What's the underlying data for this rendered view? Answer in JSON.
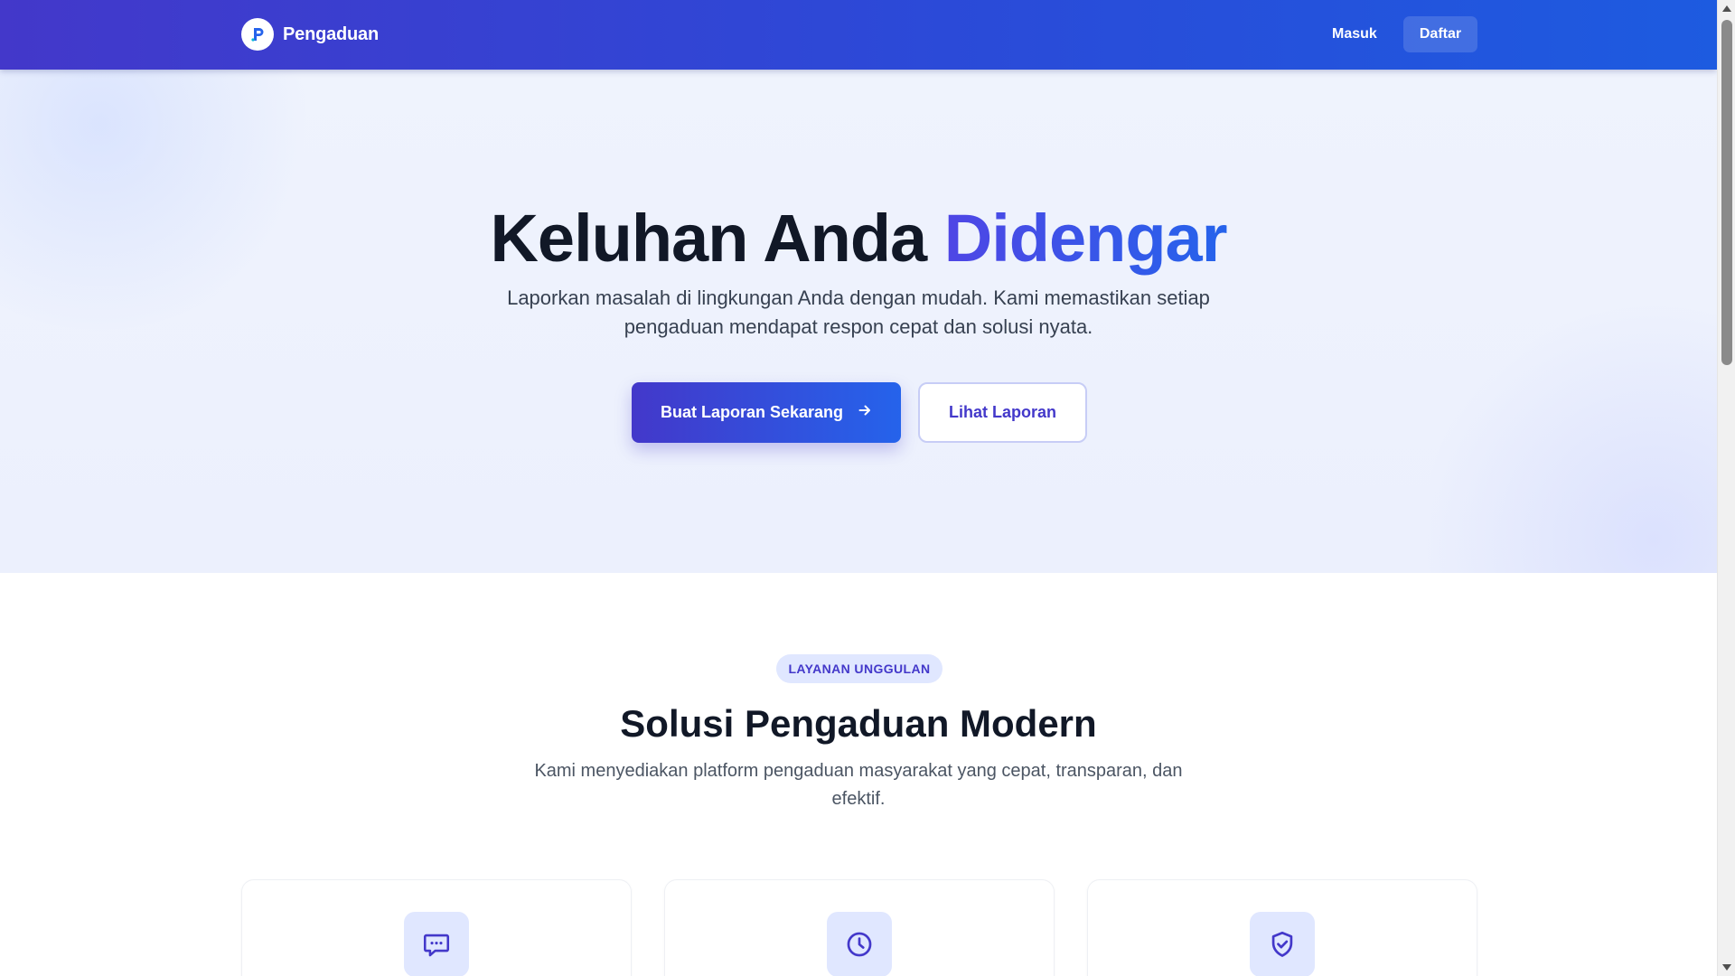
{
  "navbar": {
    "brand_name": "Pengaduan",
    "brand_logo_letter": "P",
    "login_label": "Masuk",
    "register_label": "Daftar"
  },
  "hero": {
    "title_main": "Keluhan Anda ",
    "title_accent": "Didengar",
    "subtitle": "Laporkan masalah di lingkungan Anda dengan mudah. Kami memastikan setiap pengaduan mendapat respon cepat dan solusi nyata.",
    "primary_button_label": "Buat Laporan Sekarang",
    "primary_button_icon": "arrow-right-icon",
    "secondary_button_label": "Lihat Laporan"
  },
  "features": {
    "badge": "LAYANAN UNGGULAN",
    "title": "Solusi Pengaduan Modern",
    "subtitle": "Kami menyediakan platform pengaduan masyarakat yang cepat, transparan, dan efektif.",
    "cards": [
      {
        "icon": "chat-message-icon"
      },
      {
        "icon": "clock-icon"
      },
      {
        "icon": "shield-check-icon"
      }
    ]
  },
  "colors": {
    "navbar_start": "#4338ca",
    "navbar_end": "#1d5be0",
    "accent": "#4f46e5",
    "accent_blue": "#2563eb",
    "hero_bg": "#eff3fd",
    "badge_bg": "#e0e7ff",
    "text_dark": "#111827"
  }
}
